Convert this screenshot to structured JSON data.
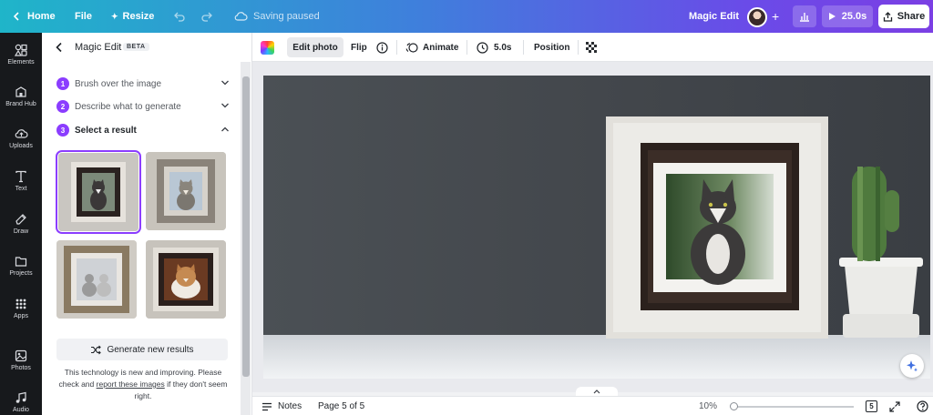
{
  "topbar": {
    "home": "Home",
    "file": "File",
    "resize": "Resize",
    "saving_status": "Saving paused",
    "doc_title": "Magic Edit",
    "duration": "25.0s",
    "share": "Share"
  },
  "rail": {
    "items": [
      {
        "label": "Elements",
        "icon": "elements-icon"
      },
      {
        "label": "Brand Hub",
        "icon": "brand-hub-icon"
      },
      {
        "label": "Uploads",
        "icon": "uploads-icon"
      },
      {
        "label": "Text",
        "icon": "text-icon"
      },
      {
        "label": "Draw",
        "icon": "draw-icon"
      },
      {
        "label": "Projects",
        "icon": "projects-icon"
      },
      {
        "label": "Apps",
        "icon": "apps-icon"
      },
      {
        "label": "Photos",
        "icon": "photos-icon"
      },
      {
        "label": "Audio",
        "icon": "audio-icon"
      }
    ]
  },
  "panel": {
    "title": "Magic Edit",
    "badge": "BETA",
    "steps": [
      {
        "num": "1",
        "label": "Brush over the image"
      },
      {
        "num": "2",
        "label": "Describe what to generate"
      },
      {
        "num": "3",
        "label": "Select a result"
      }
    ],
    "generate_button": "Generate new results",
    "disclaimer_before": "This technology is new and improving. Please check and ",
    "disclaimer_link": "report these images",
    "disclaimer_after": " if they don't seem right."
  },
  "toolbar": {
    "edit_photo": "Edit photo",
    "flip": "Flip",
    "animate": "Animate",
    "timing": "5.0s",
    "position": "Position"
  },
  "bottombar": {
    "notes": "Notes",
    "page_indicator": "Page 5 of 5",
    "zoom": "10%",
    "pages_count": "5"
  },
  "colors": {
    "accent": "#8b3dff",
    "rail_bg": "#17191c"
  }
}
